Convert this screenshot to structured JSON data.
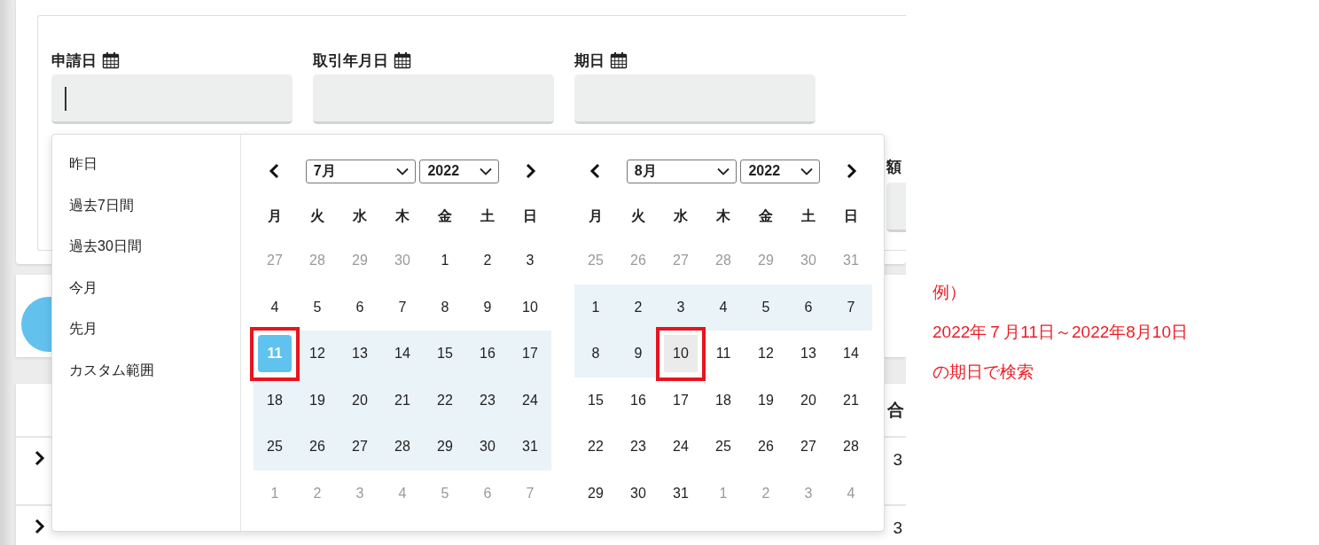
{
  "form": {
    "fields": [
      {
        "label": "申請日",
        "focused": true
      },
      {
        "label": "取引年月日",
        "focused": false
      },
      {
        "label": "期日",
        "focused": false
      }
    ],
    "partial_label": "額"
  },
  "table": {
    "header_cell": "合",
    "rows": [
      {
        "cell": "3"
      },
      {
        "cell": "3"
      }
    ]
  },
  "date_picker": {
    "ranges": [
      {
        "label": "昨日"
      },
      {
        "label": "過去7日間"
      },
      {
        "label": "過去30日間"
      },
      {
        "label": "今月"
      },
      {
        "label": "先月"
      },
      {
        "label": "カスタム範囲"
      }
    ],
    "calendars": [
      {
        "month": "7月",
        "year": "2022",
        "weekdays": [
          "月",
          "火",
          "水",
          "木",
          "金",
          "土",
          "日"
        ],
        "weeks": [
          [
            {
              "day": "27",
              "kind": "outside",
              "framed": false
            },
            {
              "day": "28",
              "kind": "outside",
              "framed": false
            },
            {
              "day": "29",
              "kind": "outside",
              "framed": false
            },
            {
              "day": "30",
              "kind": "outside",
              "framed": false
            },
            {
              "day": "1",
              "kind": "normal",
              "framed": false
            },
            {
              "day": "2",
              "kind": "normal",
              "framed": false
            },
            {
              "day": "3",
              "kind": "normal",
              "framed": false
            }
          ],
          [
            {
              "day": "4",
              "kind": "normal",
              "framed": false
            },
            {
              "day": "5",
              "kind": "normal",
              "framed": false
            },
            {
              "day": "6",
              "kind": "normal",
              "framed": false
            },
            {
              "day": "7",
              "kind": "normal",
              "framed": false
            },
            {
              "day": "8",
              "kind": "normal",
              "framed": false
            },
            {
              "day": "9",
              "kind": "normal",
              "framed": false
            },
            {
              "day": "10",
              "kind": "normal",
              "framed": false
            }
          ],
          [
            {
              "day": "11",
              "kind": "start",
              "framed": true
            },
            {
              "day": "12",
              "kind": "range",
              "framed": false
            },
            {
              "day": "13",
              "kind": "range",
              "framed": false
            },
            {
              "day": "14",
              "kind": "range",
              "framed": false
            },
            {
              "day": "15",
              "kind": "range",
              "framed": false
            },
            {
              "day": "16",
              "kind": "range",
              "framed": false
            },
            {
              "day": "17",
              "kind": "range",
              "framed": false
            }
          ],
          [
            {
              "day": "18",
              "kind": "range",
              "framed": false
            },
            {
              "day": "19",
              "kind": "range",
              "framed": false
            },
            {
              "day": "20",
              "kind": "range",
              "framed": false
            },
            {
              "day": "21",
              "kind": "range",
              "framed": false
            },
            {
              "day": "22",
              "kind": "range",
              "framed": false
            },
            {
              "day": "23",
              "kind": "range",
              "framed": false
            },
            {
              "day": "24",
              "kind": "range",
              "framed": false
            }
          ],
          [
            {
              "day": "25",
              "kind": "range",
              "framed": false
            },
            {
              "day": "26",
              "kind": "range",
              "framed": false
            },
            {
              "day": "27",
              "kind": "range",
              "framed": false
            },
            {
              "day": "28",
              "kind": "range",
              "framed": false
            },
            {
              "day": "29",
              "kind": "range",
              "framed": false
            },
            {
              "day": "30",
              "kind": "range",
              "framed": false
            },
            {
              "day": "31",
              "kind": "range",
              "framed": false
            }
          ],
          [
            {
              "day": "1",
              "kind": "outside",
              "framed": false
            },
            {
              "day": "2",
              "kind": "outside",
              "framed": false
            },
            {
              "day": "3",
              "kind": "outside",
              "framed": false
            },
            {
              "day": "4",
              "kind": "outside",
              "framed": false
            },
            {
              "day": "5",
              "kind": "outside",
              "framed": false
            },
            {
              "day": "6",
              "kind": "outside",
              "framed": false
            },
            {
              "day": "7",
              "kind": "outside",
              "framed": false
            }
          ]
        ]
      },
      {
        "month": "8月",
        "year": "2022",
        "weekdays": [
          "月",
          "火",
          "水",
          "木",
          "金",
          "土",
          "日"
        ],
        "weeks": [
          [
            {
              "day": "25",
              "kind": "outside",
              "framed": false
            },
            {
              "day": "26",
              "kind": "outside",
              "framed": false
            },
            {
              "day": "27",
              "kind": "outside",
              "framed": false
            },
            {
              "day": "28",
              "kind": "outside",
              "framed": false
            },
            {
              "day": "29",
              "kind": "outside",
              "framed": false
            },
            {
              "day": "30",
              "kind": "outside",
              "framed": false
            },
            {
              "day": "31",
              "kind": "outside",
              "framed": false
            }
          ],
          [
            {
              "day": "1",
              "kind": "range",
              "framed": false
            },
            {
              "day": "2",
              "kind": "range",
              "framed": false
            },
            {
              "day": "3",
              "kind": "range",
              "framed": false
            },
            {
              "day": "4",
              "kind": "range",
              "framed": false
            },
            {
              "day": "5",
              "kind": "range",
              "framed": false
            },
            {
              "day": "6",
              "kind": "range",
              "framed": false
            },
            {
              "day": "7",
              "kind": "range",
              "framed": false
            }
          ],
          [
            {
              "day": "8",
              "kind": "range",
              "framed": false
            },
            {
              "day": "9",
              "kind": "range",
              "framed": false
            },
            {
              "day": "10",
              "kind": "end",
              "framed": true
            },
            {
              "day": "11",
              "kind": "normal",
              "framed": false
            },
            {
              "day": "12",
              "kind": "normal",
              "framed": false
            },
            {
              "day": "13",
              "kind": "normal",
              "framed": false
            },
            {
              "day": "14",
              "kind": "normal",
              "framed": false
            }
          ],
          [
            {
              "day": "15",
              "kind": "normal",
              "framed": false
            },
            {
              "day": "16",
              "kind": "normal",
              "framed": false
            },
            {
              "day": "17",
              "kind": "normal",
              "framed": false
            },
            {
              "day": "18",
              "kind": "normal",
              "framed": false
            },
            {
              "day": "19",
              "kind": "normal",
              "framed": false
            },
            {
              "day": "20",
              "kind": "normal",
              "framed": false
            },
            {
              "day": "21",
              "kind": "normal",
              "framed": false
            }
          ],
          [
            {
              "day": "22",
              "kind": "normal",
              "framed": false
            },
            {
              "day": "23",
              "kind": "normal",
              "framed": false
            },
            {
              "day": "24",
              "kind": "normal",
              "framed": false
            },
            {
              "day": "25",
              "kind": "normal",
              "framed": false
            },
            {
              "day": "26",
              "kind": "normal",
              "framed": false
            },
            {
              "day": "27",
              "kind": "normal",
              "framed": false
            },
            {
              "day": "28",
              "kind": "normal",
              "framed": false
            }
          ],
          [
            {
              "day": "29",
              "kind": "normal",
              "framed": false
            },
            {
              "day": "30",
              "kind": "normal",
              "framed": false
            },
            {
              "day": "31",
              "kind": "normal",
              "framed": false
            },
            {
              "day": "1",
              "kind": "outside",
              "framed": false
            },
            {
              "day": "2",
              "kind": "outside",
              "framed": false
            },
            {
              "day": "3",
              "kind": "outside",
              "framed": false
            },
            {
              "day": "4",
              "kind": "outside",
              "framed": false
            }
          ]
        ]
      }
    ]
  },
  "annotation": {
    "lines": [
      "例）",
      "2022年７月11日～2022年8月10日",
      "の期日で検索"
    ]
  }
}
